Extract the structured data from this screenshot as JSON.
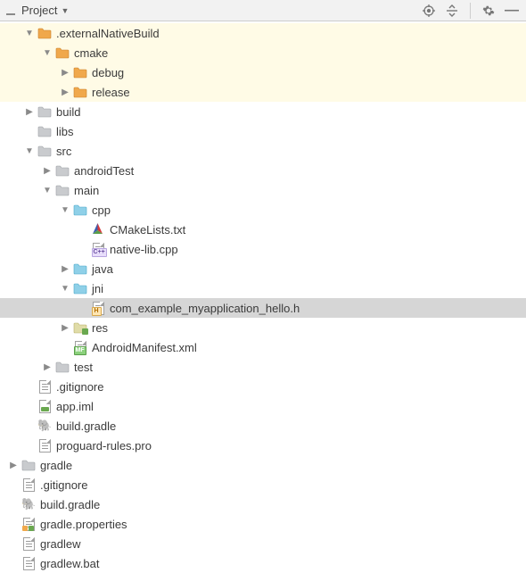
{
  "toolbar": {
    "title": "Project"
  },
  "tree": [
    {
      "indent": 18,
      "arrow": "down",
      "icon": "folder-orange",
      "label": ".externalNativeBuild",
      "hl": "yellow"
    },
    {
      "indent": 38,
      "arrow": "down",
      "icon": "folder-orange",
      "label": "cmake",
      "hl": "yellow"
    },
    {
      "indent": 58,
      "arrow": "right",
      "icon": "folder-orange",
      "label": "debug",
      "hl": "yellow"
    },
    {
      "indent": 58,
      "arrow": "right",
      "icon": "folder-orange",
      "label": "release",
      "hl": "yellow"
    },
    {
      "indent": 18,
      "arrow": "right",
      "icon": "folder-grey",
      "label": "build"
    },
    {
      "indent": 18,
      "arrow": "none",
      "icon": "folder-grey",
      "label": "libs"
    },
    {
      "indent": 18,
      "arrow": "down",
      "icon": "folder-grey",
      "label": "src"
    },
    {
      "indent": 38,
      "arrow": "right",
      "icon": "folder-grey",
      "label": "androidTest"
    },
    {
      "indent": 38,
      "arrow": "down",
      "icon": "folder-grey",
      "label": "main"
    },
    {
      "indent": 58,
      "arrow": "down",
      "icon": "folder-blue",
      "label": "cpp"
    },
    {
      "indent": 78,
      "arrow": "none",
      "icon": "cmake",
      "label": "CMakeLists.txt"
    },
    {
      "indent": 78,
      "arrow": "none",
      "icon": "cpp",
      "label": "native-lib.cpp"
    },
    {
      "indent": 58,
      "arrow": "right",
      "icon": "folder-blue",
      "label": "java"
    },
    {
      "indent": 58,
      "arrow": "down",
      "icon": "folder-blue",
      "label": "jni"
    },
    {
      "indent": 78,
      "arrow": "none",
      "icon": "hfile",
      "label": "com_example_myapplication_hello.h",
      "selected": true
    },
    {
      "indent": 58,
      "arrow": "right",
      "icon": "folder-res",
      "label": "res"
    },
    {
      "indent": 58,
      "arrow": "none",
      "icon": "manifest",
      "label": "AndroidManifest.xml"
    },
    {
      "indent": 38,
      "arrow": "right",
      "icon": "folder-grey",
      "label": "test"
    },
    {
      "indent": 18,
      "arrow": "none",
      "icon": "file",
      "label": ".gitignore"
    },
    {
      "indent": 18,
      "arrow": "none",
      "icon": "iml",
      "label": "app.iml"
    },
    {
      "indent": 18,
      "arrow": "none",
      "icon": "gradle",
      "label": "build.gradle"
    },
    {
      "indent": 18,
      "arrow": "none",
      "icon": "file",
      "label": "proguard-rules.pro"
    },
    {
      "indent": 0,
      "arrow": "right",
      "icon": "folder-grey",
      "label": "gradle"
    },
    {
      "indent": 0,
      "arrow": "none",
      "icon": "file",
      "label": ".gitignore"
    },
    {
      "indent": 0,
      "arrow": "none",
      "icon": "gradle",
      "label": "build.gradle"
    },
    {
      "indent": 0,
      "arrow": "none",
      "icon": "prop",
      "label": "gradle.properties"
    },
    {
      "indent": 0,
      "arrow": "none",
      "icon": "file",
      "label": "gradlew"
    },
    {
      "indent": 0,
      "arrow": "none",
      "icon": "file",
      "label": "gradlew.bat"
    }
  ]
}
